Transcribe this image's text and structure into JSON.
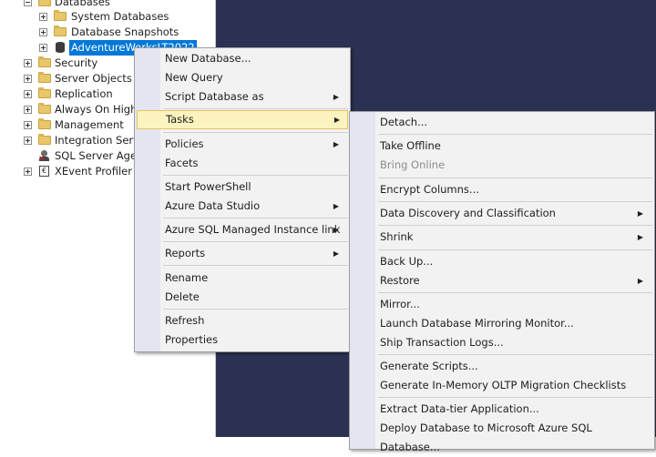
{
  "tree": {
    "databases": "Databases",
    "system_databases": "System Databases",
    "database_snapshots": "Database Snapshots",
    "adventureworks": "AdventureWorksLT2022",
    "security": "Security",
    "server_objects": "Server Objects",
    "replication": "Replication",
    "always_on": "Always On High Availability",
    "management": "Management",
    "integration_services": "Integration Services Catalogs",
    "sql_server_agent": "SQL Server Agent",
    "xevent_profiler": "XEvent Profiler"
  },
  "context_menu": {
    "new_database": "New Database...",
    "new_query": "New Query",
    "script_database_as": "Script Database as",
    "tasks": "Tasks",
    "policies": "Policies",
    "facets": "Facets",
    "start_powershell": "Start PowerShell",
    "azure_data_studio": "Azure Data Studio",
    "azure_sql_mi_link": "Azure SQL Managed Instance link",
    "reports": "Reports",
    "rename": "Rename",
    "delete": "Delete",
    "refresh": "Refresh",
    "properties": "Properties"
  },
  "tasks_menu": {
    "detach": "Detach...",
    "take_offline": "Take Offline",
    "bring_online": "Bring Online",
    "encrypt_columns": "Encrypt Columns...",
    "data_discovery": "Data Discovery and Classification",
    "shrink": "Shrink",
    "back_up": "Back Up...",
    "restore": "Restore",
    "mirror": "Mirror...",
    "launch_mirroring_monitor": "Launch Database Mirroring Monitor...",
    "ship_transaction_logs": "Ship Transaction Logs...",
    "generate_scripts": "Generate Scripts...",
    "generate_inmemory": "Generate In-Memory OLTP Migration Checklists",
    "extract_data_tier": "Extract Data-tier Application...",
    "deploy_to_azure": "Deploy Database to Microsoft Azure SQL Database..."
  },
  "icons": {
    "submenu_arrow": "▶",
    "expand_plus": "+",
    "collapse_minus": "−"
  },
  "colors": {
    "selection": "#0078d7",
    "menu_highlight": "#fdf3bf",
    "workspace": "#2b3152"
  }
}
